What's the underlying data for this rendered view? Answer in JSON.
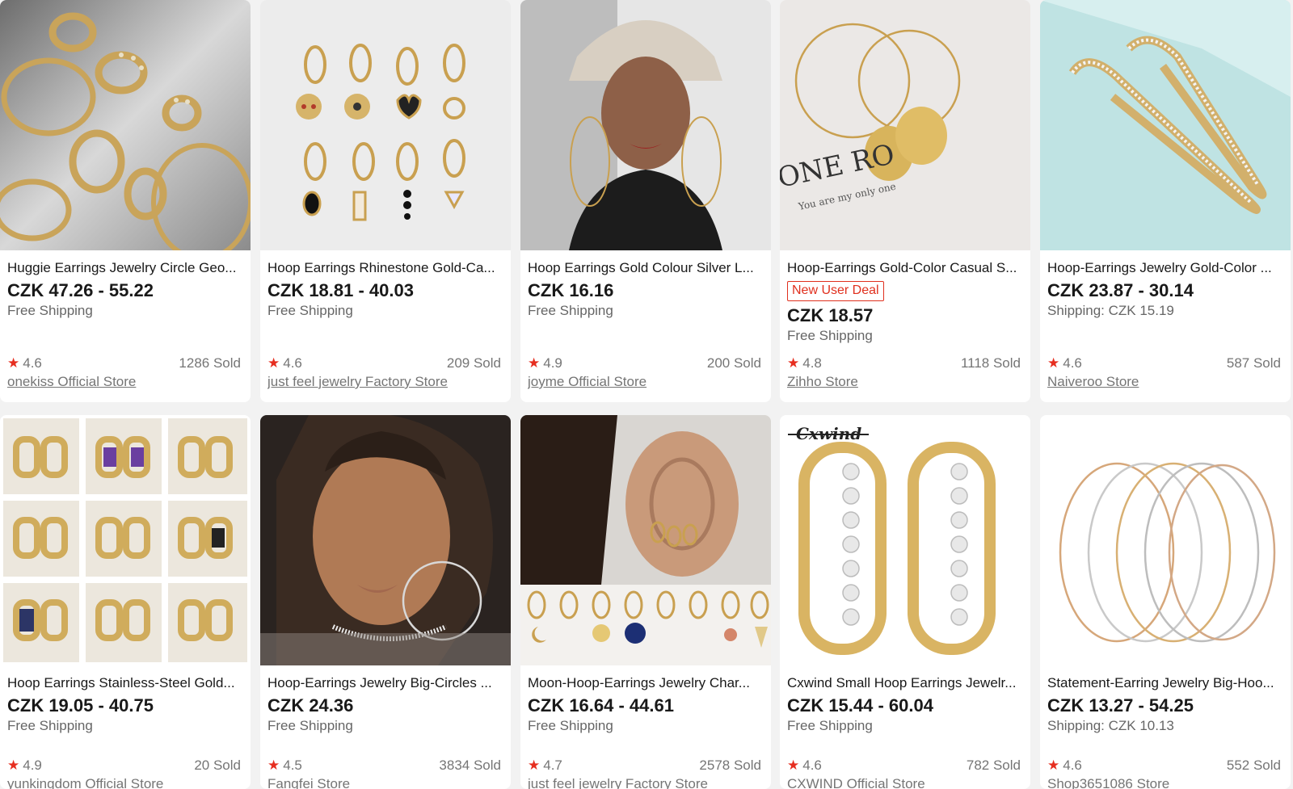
{
  "products": [
    {
      "title": "Huggie Earrings Jewelry Circle Geo...",
      "price": "CZK 47.26 - 55.22",
      "shipping": "Free Shipping",
      "rating": "4.6",
      "sold": "1286 Sold",
      "store": "onekiss Official Store",
      "image": "gold-hoops-flatlay"
    },
    {
      "title": "Hoop Earrings Rhinestone Gold-Ca...",
      "price": "CZK 18.81 - 40.03",
      "shipping": "Free Shipping",
      "rating": "4.6",
      "sold": "209 Sold",
      "store": "just feel jewelry Factory Store",
      "image": "charm-huggies-set"
    },
    {
      "title": "Hoop Earrings Gold Colour Silver L...",
      "price": "CZK 16.16",
      "shipping": "Free Shipping",
      "rating": "4.9",
      "sold": "200 Sold",
      "store": "joyme Official Store",
      "image": "model-cap-hoops"
    },
    {
      "title": "Hoop-Earrings Gold-Color Casual S...",
      "badge": "New User Deal",
      "price": "CZK 18.57",
      "shipping": "Free Shipping",
      "rating": "4.8",
      "sold": "1118 Sold",
      "store": "Zihho Store",
      "image": "coin-hoops",
      "image_text": [
        "ONE RO",
        "You are my only one"
      ]
    },
    {
      "title": "Hoop-Earrings Jewelry Gold-Color ...",
      "price": "CZK 23.87 - 30.14",
      "shipping": "Shipping: CZK 15.19",
      "rating": "4.6",
      "sold": "587 Sold",
      "store": "Naiveroo Store",
      "image": "crystal-oval-hoops"
    },
    {
      "title": "Hoop Earrings Stainless-Steel Gold...",
      "price": "CZK 19.05 - 40.75",
      "shipping": "Free Shipping",
      "rating": "4.9",
      "sold": "20 Sold",
      "store": "yunkingdom Official Store",
      "image": "huggie-grid-nine"
    },
    {
      "title": "Hoop-Earrings Jewelry Big-Circles ...",
      "price": "CZK 24.36",
      "shipping": "Free Shipping",
      "rating": "4.5",
      "sold": "3834 Sold",
      "store": "Fangfei Store",
      "image": "model-big-hoops"
    },
    {
      "title": "Moon-Hoop-Earrings Jewelry Char...",
      "price": "CZK 16.64 - 44.61",
      "shipping": "Free Shipping",
      "rating": "4.7",
      "sold": "2578 Sold",
      "store": "just feel jewelry Factory Store",
      "image": "ear-charms"
    },
    {
      "title": "Cxwind Small Hoop Earrings Jewelr...",
      "price": "CZK 15.44 - 60.04",
      "shipping": "Free Shipping",
      "rating": "4.6",
      "sold": "782 Sold",
      "store": "CXWIND Official Store",
      "image": "crystal-huggies",
      "image_text": [
        "Cxwind"
      ]
    },
    {
      "title": "Statement-Earring Jewelry Big-Hoo...",
      "price": "CZK 13.27 - 54.25",
      "shipping": "Shipping: CZK 10.13",
      "rating": "4.6",
      "sold": "552 Sold",
      "store": "Shop3651086 Store",
      "image": "thin-big-hoops"
    }
  ],
  "colors": {
    "star": "#e62e20",
    "badge": "#e0301e",
    "background": "#f2f2f2",
    "card": "#ffffff"
  }
}
